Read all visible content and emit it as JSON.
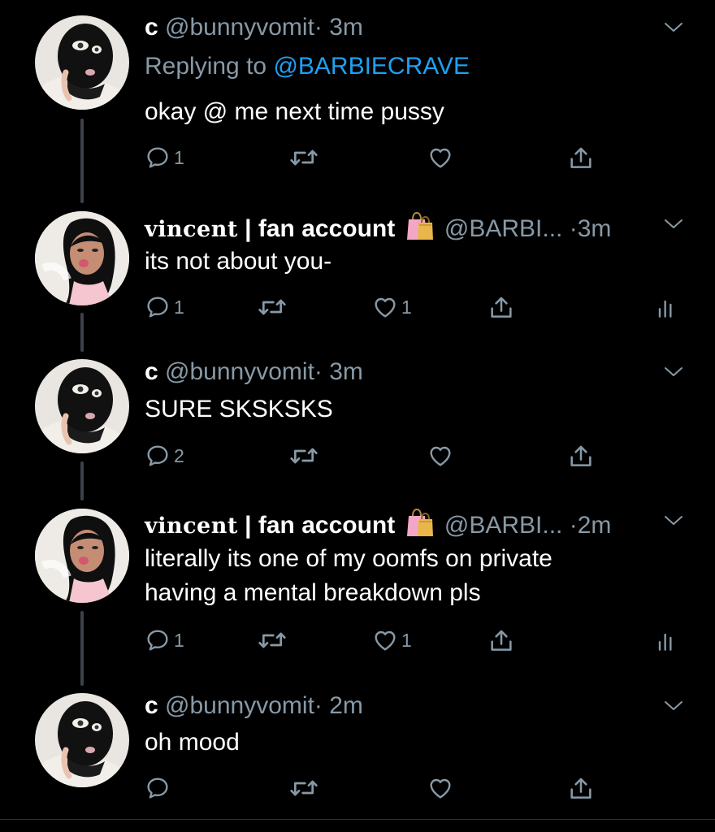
{
  "tweets": [
    {
      "name": "c",
      "handle": "@bunnyvomit",
      "time": "· 3m",
      "replying_prefix": "Replying to ",
      "replying_handle": "@BARBIECRAVE",
      "text": "okay @ me next time pussy",
      "replies": "1",
      "likes": ""
    },
    {
      "name_deco": "vincent",
      "name": " | fan account",
      "handle": "@BARBI...",
      "time": "·3m",
      "text": "its not about you-",
      "replies": "1",
      "likes": "1"
    },
    {
      "name": "c",
      "handle": "@bunnyvomit",
      "time": "· 3m",
      "text": "SURE SKSKSKS",
      "replies": "2",
      "likes": ""
    },
    {
      "name_deco": "vincent",
      "name": " | fan account",
      "handle": "@BARBI...",
      "time": "·2m",
      "text": "literally its one of my oomfs on private\nhaving a mental breakdown pls",
      "replies": "1",
      "likes": "1"
    },
    {
      "name": "c",
      "handle": "@bunnyvomit",
      "time": "· 2m",
      "text": "oh mood",
      "replies": "",
      "likes": ""
    }
  ],
  "colors": {
    "background": "#000000",
    "text": "#ffffff",
    "muted": "#8899a6",
    "link": "#1da1f2",
    "thread_line": "#3d4248",
    "bag_emoji": "#f4a6c6"
  },
  "icons": [
    "reply-icon",
    "retweet-icon",
    "like-icon",
    "share-icon",
    "analytics-icon",
    "chevron-down-icon",
    "shopping-bags-emoji"
  ]
}
